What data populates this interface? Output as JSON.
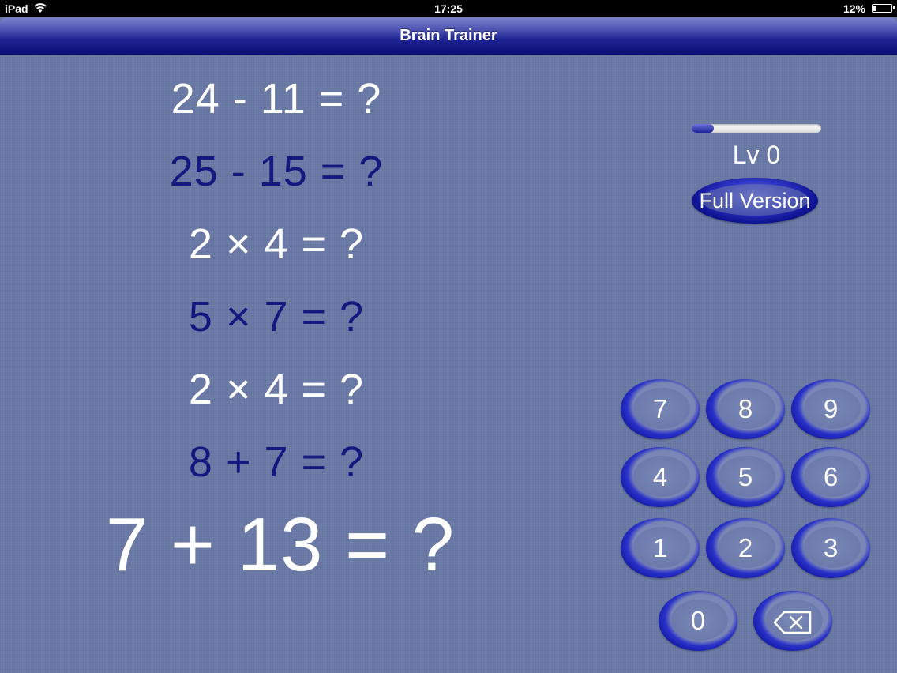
{
  "status_bar": {
    "device": "iPad",
    "time": "17:25",
    "battery_percent": "12%",
    "battery_level": 0.12
  },
  "nav_bar": {
    "title": "Brain Trainer"
  },
  "problems": [
    {
      "text": "24 - 11 = ?",
      "color": "#ffffff"
    },
    {
      "text": "25 - 15 = ?",
      "color": "#14187f"
    },
    {
      "text": "2 × 4 = ?",
      "color": "#ffffff"
    },
    {
      "text": "5 × 7 = ?",
      "color": "#14187f"
    },
    {
      "text": "2 × 4 = ?",
      "color": "#ffffff"
    },
    {
      "text": "8 + 7 = ?",
      "color": "#14187f"
    }
  ],
  "current_problem": "7 + 13 = ?",
  "level": {
    "label": "Lv 0",
    "progress": 0.17
  },
  "full_version_label": "Full Version",
  "keypad": {
    "keys": [
      "7",
      "8",
      "9",
      "4",
      "5",
      "6",
      "1",
      "2",
      "3",
      "0"
    ],
    "backspace_icon": "backspace-icon"
  },
  "colors": {
    "background": "#6a79a5",
    "accent": "#141aa6",
    "dark_text": "#14187f"
  }
}
